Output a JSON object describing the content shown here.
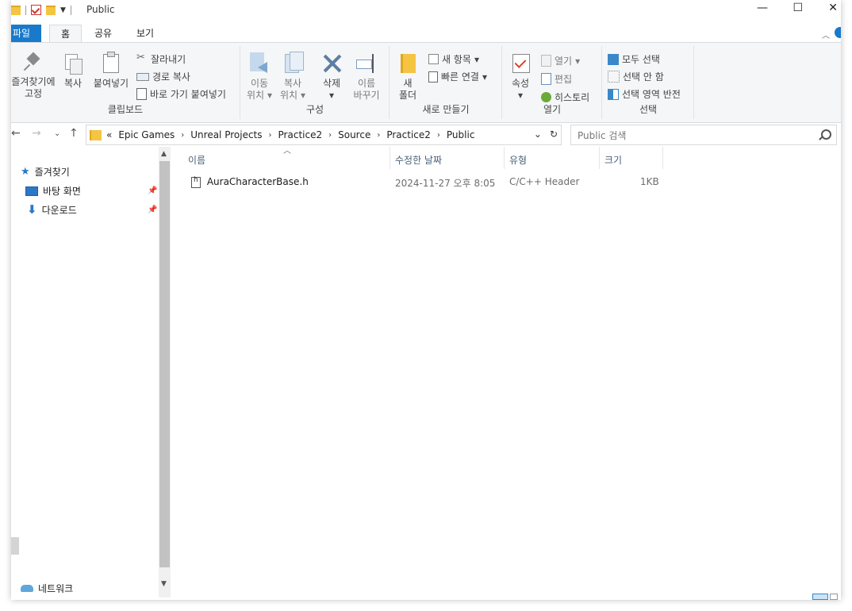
{
  "window": {
    "title": "Public",
    "minimize": "—",
    "maximize": "☐",
    "close": "✕"
  },
  "tabs": {
    "file": "파일",
    "home": "홈",
    "share": "공유",
    "view": "보기"
  },
  "ribbon": {
    "clipboard": {
      "label": "클립보드",
      "pin_line1": "즐겨찾기에",
      "pin_line2": "고정",
      "copy": "복사",
      "paste": "붙여넣기",
      "cut": "잘라내기",
      "copy_path": "경로 복사",
      "paste_shortcut": "바로 가기 붙여넣기"
    },
    "organize": {
      "label": "구성",
      "move_line1": "이동",
      "move_line2": "위치",
      "copy_line1": "복사",
      "copy_line2": "위치",
      "delete": "삭제",
      "rename_line1": "이름",
      "rename_line2": "바꾸기"
    },
    "new": {
      "label": "새로 만들기",
      "folder_line1": "새",
      "folder_line2": "폴더",
      "new_item": "새 항목",
      "easy_access": "빠른 연결"
    },
    "open": {
      "label": "열기",
      "properties": "속성",
      "open": "열기",
      "edit": "편집",
      "history": "히스토리"
    },
    "select": {
      "label": "선택",
      "select_all": "모두 선택",
      "select_none": "선택 안 함",
      "invert": "선택 영역 반전"
    }
  },
  "address": {
    "overflow": "«",
    "crumbs": [
      "Epic Games",
      "Unreal Projects",
      "Practice2",
      "Source",
      "Practice2",
      "Public"
    ]
  },
  "search": {
    "placeholder": "Public 검색"
  },
  "nav": {
    "quick_access": "즐겨찾기",
    "desktop": "바탕 화면",
    "downloads": "다운로드",
    "network": "네트워크"
  },
  "columns": {
    "name": "이름",
    "modified": "수정한 날짜",
    "type": "유형",
    "size": "크기"
  },
  "files": [
    {
      "name": "AuraCharacterBase.h",
      "modified": "2024-11-27 오후 8:05",
      "type": "C/C++ Header",
      "size": "1KB"
    }
  ]
}
